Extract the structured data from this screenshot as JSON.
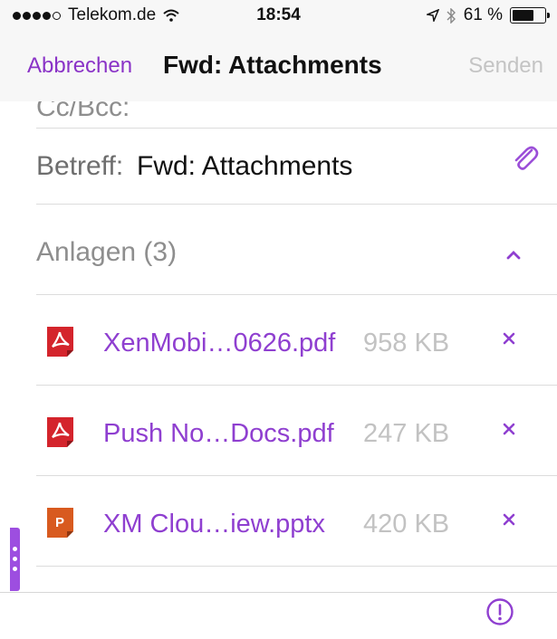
{
  "status_bar": {
    "carrier": "Telekom.de",
    "time": "18:54",
    "battery": "61 %",
    "battery_level": 0.61,
    "icons": [
      "signal-dots-icon",
      "wifi-icon",
      "location-arrow-icon",
      "bluetooth-icon",
      "battery-icon"
    ]
  },
  "nav": {
    "cancel_label": "Abbrechen",
    "title": "Fwd: Attachments",
    "send_label": "Senden"
  },
  "compose": {
    "cc_label": "Cc/Bcc:",
    "subject_label": "Betreff:",
    "subject_value": "Fwd: Attachments"
  },
  "attachments": {
    "header": "Anlagen (3)",
    "items": [
      {
        "name": "XenMobi…0626.pdf",
        "size": "958 KB",
        "type": "pdf"
      },
      {
        "name": "Push No…Docs.pdf",
        "size": "247 KB",
        "type": "pdf"
      },
      {
        "name": "XM Clou…iew.pptx",
        "size": "420 KB",
        "type": "pptx"
      }
    ]
  },
  "colors": {
    "accent": "#8f3fd0",
    "pdf_icon": "#d4242c",
    "pptx_icon": "#d85a1f",
    "disabled": "#c4c4c4"
  }
}
